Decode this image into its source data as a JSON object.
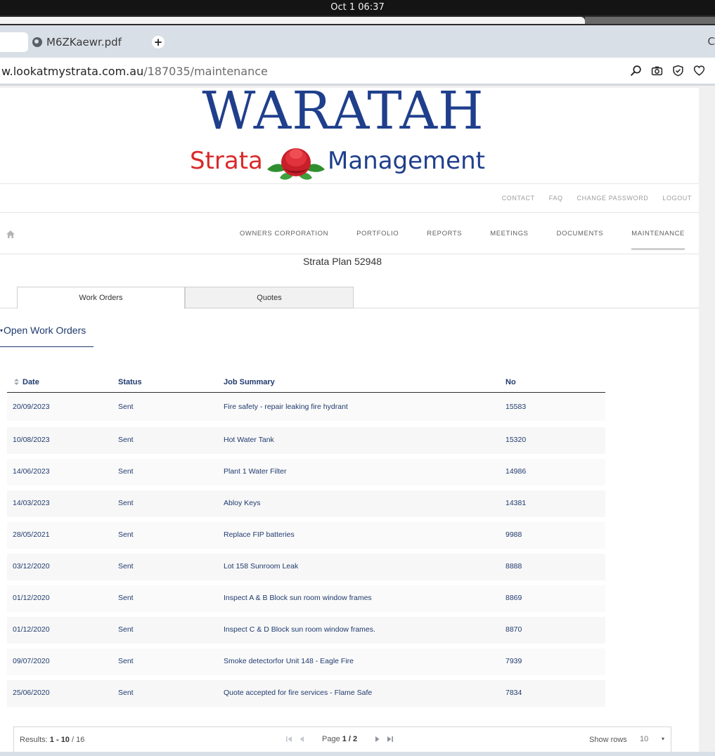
{
  "os": {
    "clock": "Oct 1  06:37"
  },
  "browser": {
    "tab_title": "M6ZKaewr.pdf",
    "newtab_label": "+",
    "edge_glyph": "C",
    "url_host": "w.lookatmystrata.com.au",
    "url_path": "/187035/maintenance"
  },
  "logo": {
    "main": "WARATAH",
    "left": "Strata",
    "right": "Management"
  },
  "util_nav": [
    "CONTACT",
    "FAQ",
    "CHANGE PASSWORD",
    "LOGOUT"
  ],
  "main_nav": [
    "OWNERS CORPORATION",
    "PORTFOLIO",
    "REPORTS",
    "MEETINGS",
    "DOCUMENTS",
    "MAINTENANCE"
  ],
  "plan_title": "Strata Plan 52948",
  "tabs": {
    "work_orders": "Work Orders",
    "quotes": "Quotes"
  },
  "section": {
    "caret": "▾",
    "title": "Open Work Orders"
  },
  "table": {
    "headers": {
      "date": "Date",
      "status": "Status",
      "job": "Job Summary",
      "no": "No"
    },
    "rows": [
      {
        "date": "20/09/2023",
        "status": "Sent",
        "job": "Fire safety - repair leaking fire hydrant",
        "no": "15583"
      },
      {
        "date": "10/08/2023",
        "status": "Sent",
        "job": "Hot Water Tank",
        "no": "15320"
      },
      {
        "date": "14/06/2023",
        "status": "Sent",
        "job": "Plant 1 Water Filter",
        "no": "14986"
      },
      {
        "date": "14/03/2023",
        "status": "Sent",
        "job": "Abloy Keys",
        "no": "14381"
      },
      {
        "date": "28/05/2021",
        "status": "Sent",
        "job": "Replace FIP batteries",
        "no": "9988"
      },
      {
        "date": "03/12/2020",
        "status": "Sent",
        "job": "Lot 158 Sunroom Leak",
        "no": "8888"
      },
      {
        "date": "01/12/2020",
        "status": "Sent",
        "job": "Inspect A & B Block sun room window frames",
        "no": "8869"
      },
      {
        "date": "01/12/2020",
        "status": "Sent",
        "job": "Inspect C & D Block sun room window frames.",
        "no": "8870"
      },
      {
        "date": "09/07/2020",
        "status": "Sent",
        "job": "Smoke detectorfor Unit 148 - Eagle Fire",
        "no": "7939"
      },
      {
        "date": "25/06/2020",
        "status": "Sent",
        "job": "Quote accepted for fire services - Flame Safe",
        "no": "7834"
      }
    ]
  },
  "pager": {
    "results_label": "Results: ",
    "results_range": "1 - 10",
    "results_total": " / 16",
    "page_label": "Page ",
    "page_value": "1 / 2",
    "show_rows_label": "Show rows",
    "rows_value": "10",
    "rows_caret": "▾"
  }
}
